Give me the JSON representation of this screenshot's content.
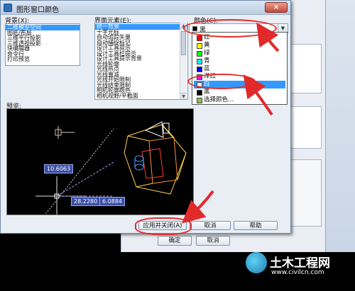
{
  "window": {
    "title": "图形窗口颜色",
    "close_glyph": "×"
  },
  "context": {
    "label": "背景(X):",
    "items": [
      "二维模型空间",
      "图纸/布局",
      "三维平行投影",
      "三维透视投影",
      "块编辑器",
      "命令行",
      "打印预览"
    ],
    "selected_index": 0
  },
  "interface_element": {
    "label": "界面元素(E):",
    "items": [
      "统一背景",
      "十字光标",
      "自动追踪矢量",
      "自动捕捉标记",
      "设计工具提示",
      "设计工具栏提示",
      "设计工具提示背景",
      "光线轮廓",
      "光线热点",
      "光线衰减",
      "光线开始限制",
      "光线结束限制",
      "相机轮廓颜色",
      "相机视野/平截面"
    ],
    "selected_index": 0
  },
  "color": {
    "label": "颜色(C):",
    "selected": "黑",
    "selected_swatch": "#000000",
    "options": [
      {
        "name": "红",
        "swatch": "#ff0000"
      },
      {
        "name": "黄",
        "swatch": "#ffff00"
      },
      {
        "name": "绿",
        "swatch": "#00ff00"
      },
      {
        "name": "青",
        "swatch": "#00ffff"
      },
      {
        "name": "蓝",
        "swatch": "#0000ff"
      },
      {
        "name": "洋红",
        "swatch": "#ff00ff"
      },
      {
        "name": "白",
        "swatch": "#ffffff"
      },
      {
        "name": "黑",
        "swatch": "#000000"
      },
      {
        "name": "选择颜色...",
        "swatch": "#88c060"
      }
    ],
    "highlighted_index": 6
  },
  "preview": {
    "label": "预览:",
    "tooltip_vertical": "10.6063",
    "tooltip_x": "28.2280",
    "tooltip_y": "6.0884"
  },
  "buttons": {
    "apply_close": "应用并关闭(A)",
    "cancel": "取消",
    "help": "帮助"
  },
  "parent_dialog": {
    "ok": "确定",
    "cancel": "取消",
    "fragment_v": "V)"
  },
  "watermark": {
    "title": "土木工程网",
    "url": "www.civilcn.com"
  },
  "colors": {
    "annotation": "#e22a2a",
    "selection": "#3399ff"
  }
}
